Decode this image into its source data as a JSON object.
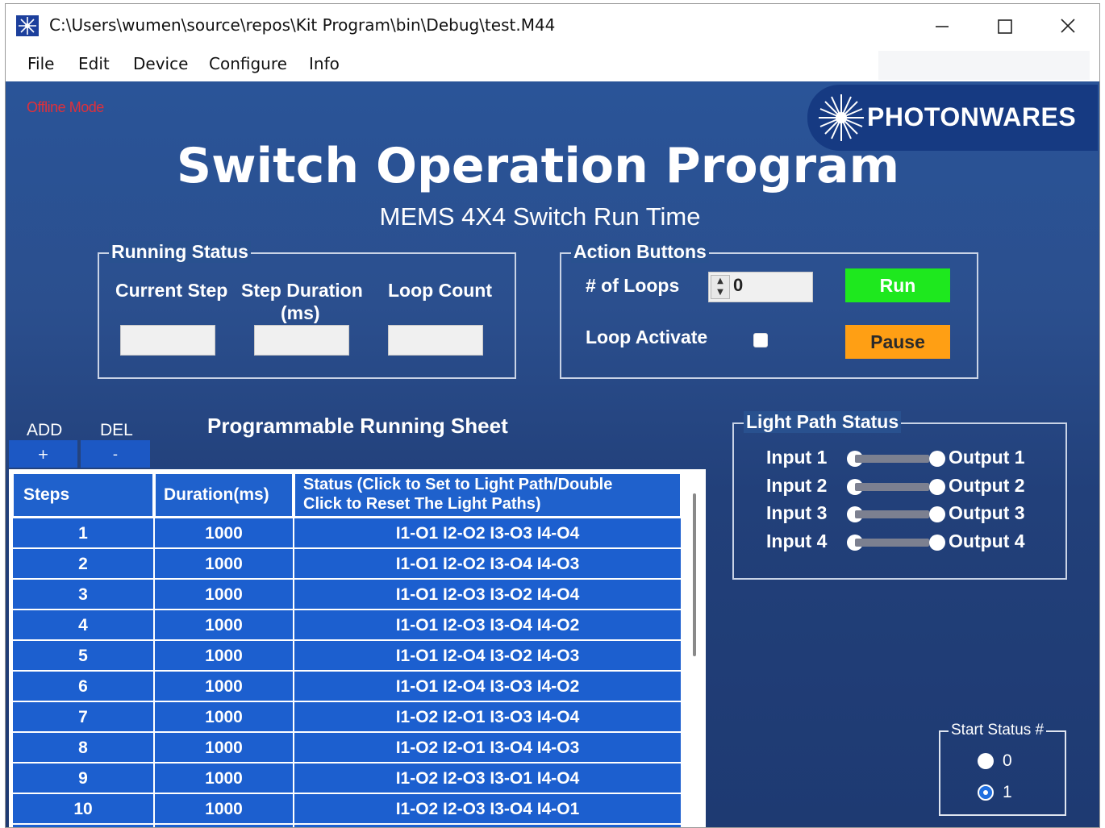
{
  "window": {
    "title": "C:\\Users\\wumen\\source\\repos\\Kit Program\\bin\\Debug\\test.M44",
    "controls": [
      "minimize",
      "maximize",
      "close"
    ]
  },
  "menu": {
    "file": "File",
    "edit": "Edit",
    "device": "Device",
    "configure": "Configure",
    "info": "Info"
  },
  "app": {
    "offline_mode": "Offline Mode",
    "logo_text": "PHOTONWARES",
    "title": "Switch Operation Program",
    "subtitle": "MEMS 4X4 Switch Run Time"
  },
  "running_status": {
    "title": "Running Status",
    "current_step": "Current Step",
    "step_duration_1": "Step Duration",
    "step_duration_2": "(ms)",
    "loop_count": "Loop Count",
    "current_step_value": "",
    "step_duration_value": "",
    "loop_count_value": ""
  },
  "action_buttons": {
    "title": "Action Buttons",
    "loops_label": "# of Loops",
    "loops_value": "0",
    "loop_activate_label": "Loop Activate",
    "loop_activate_checked": false,
    "run": "Run",
    "pause": "Pause",
    "run_color": "#1ee81e",
    "pause_color": "#ff9f14"
  },
  "sheet": {
    "add_label": "ADD",
    "del_label": "DEL",
    "add_button": "+",
    "del_button": "-",
    "title": "Programmable Running Sheet",
    "headers": {
      "steps": "Steps",
      "duration": "Duration(ms)",
      "status_1": "Status (Click to Set to Light Path/Double",
      "status_2": "Click to Reset The Light Paths)"
    },
    "rows": [
      {
        "step": "1",
        "duration": "1000",
        "status": "I1-O1 I2-O2 I3-O3 I4-O4"
      },
      {
        "step": "2",
        "duration": "1000",
        "status": "I1-O1 I2-O2 I3-O4 I4-O3"
      },
      {
        "step": "3",
        "duration": "1000",
        "status": "I1-O1 I2-O3 I3-O2 I4-O4"
      },
      {
        "step": "4",
        "duration": "1000",
        "status": "I1-O1 I2-O3 I3-O4 I4-O2"
      },
      {
        "step": "5",
        "duration": "1000",
        "status": "I1-O1 I2-O4 I3-O2 I4-O3"
      },
      {
        "step": "6",
        "duration": "1000",
        "status": "I1-O1 I2-O4 I3-O3 I4-O2"
      },
      {
        "step": "7",
        "duration": "1000",
        "status": "I1-O2 I2-O1 I3-O3 I4-O4"
      },
      {
        "step": "8",
        "duration": "1000",
        "status": "I1-O2 I2-O1 I3-O4 I4-O3"
      },
      {
        "step": "9",
        "duration": "1000",
        "status": "I1-O2 I2-O3 I3-O1 I4-O4"
      },
      {
        "step": "10",
        "duration": "1000",
        "status": "I1-O2 I2-O3 I3-O4 I4-O1"
      }
    ]
  },
  "light_path": {
    "title": "Light Path Status",
    "paths": [
      {
        "input": "Input 1",
        "output": "Output 1"
      },
      {
        "input": "Input 2",
        "output": "Output 2"
      },
      {
        "input": "Input 3",
        "output": "Output 3"
      },
      {
        "input": "Input 4",
        "output": "Output 4"
      }
    ]
  },
  "start_status": {
    "title": "Start Status #",
    "options": [
      "0",
      "1"
    ],
    "selected": "1"
  },
  "colors": {
    "background_top": "#2a5498",
    "background_bottom": "#1e3a72",
    "table_cell": "#1c5fcf",
    "offline_text": "#e0303a"
  }
}
